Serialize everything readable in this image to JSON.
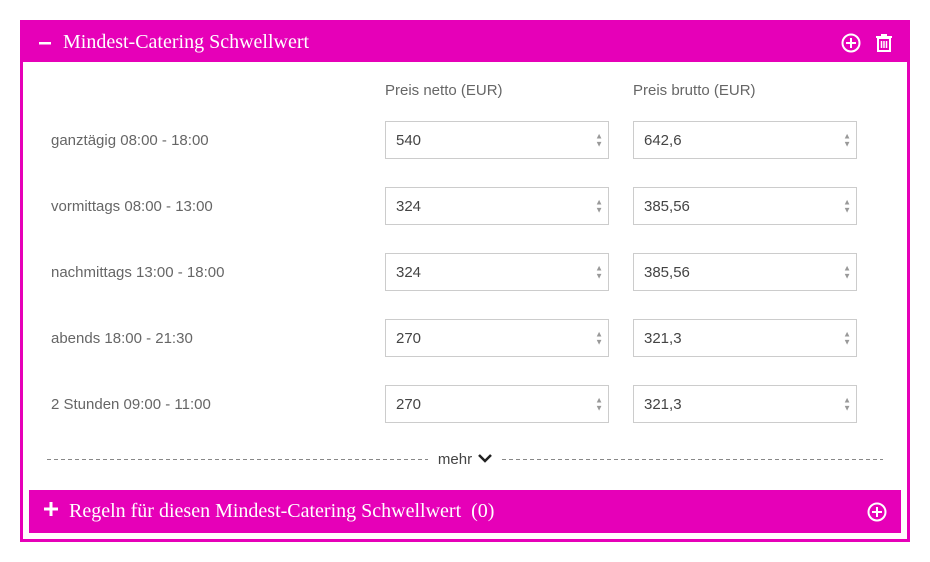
{
  "header": {
    "title": "Mindest-Catering Schwellwert"
  },
  "columns": {
    "netto": "Preis netto (EUR)",
    "brutto": "Preis brutto (EUR)"
  },
  "rows": [
    {
      "label": "ganztägig 08:00 - 18:00",
      "netto": "540",
      "brutto": "642,6"
    },
    {
      "label": "vormittags 08:00 - 13:00",
      "netto": "324",
      "brutto": "385,56"
    },
    {
      "label": "nachmittags 13:00 - 18:00",
      "netto": "324",
      "brutto": "385,56"
    },
    {
      "label": "abends 18:00 - 21:30",
      "netto": "270",
      "brutto": "321,3"
    },
    {
      "label": "2 Stunden 09:00 - 11:00",
      "netto": "270",
      "brutto": "321,3"
    }
  ],
  "more_label": "mehr",
  "subbar": {
    "title": "Regeln für diesen Mindest-Catering Schwellwert",
    "count": "(0)"
  }
}
